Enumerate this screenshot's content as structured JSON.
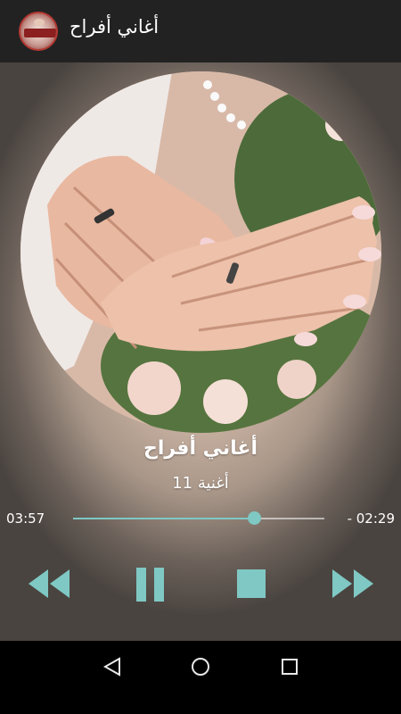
{
  "app_bar": {
    "title": "أغاني أفراح",
    "logo_icon": "app-logo-icon",
    "background": "#222222"
  },
  "player": {
    "song_title": "أغاني أفراح",
    "song_subtitle": "أغنية 11",
    "time_elapsed": "03:57",
    "time_remaining": "- 02:29",
    "progress": 0.72,
    "accent_color": "#7fc8c4"
  },
  "controls": [
    {
      "name": "rewind-button",
      "icon": "rewind-icon"
    },
    {
      "name": "pause-button",
      "icon": "pause-icon"
    },
    {
      "name": "stop-button",
      "icon": "stop-icon"
    },
    {
      "name": "fast-forward-button",
      "icon": "fast-forward-icon"
    }
  ],
  "nav_bar": {
    "back_icon": "back-triangle-icon",
    "home_icon": "home-circle-icon",
    "recents_icon": "recents-square-icon"
  }
}
